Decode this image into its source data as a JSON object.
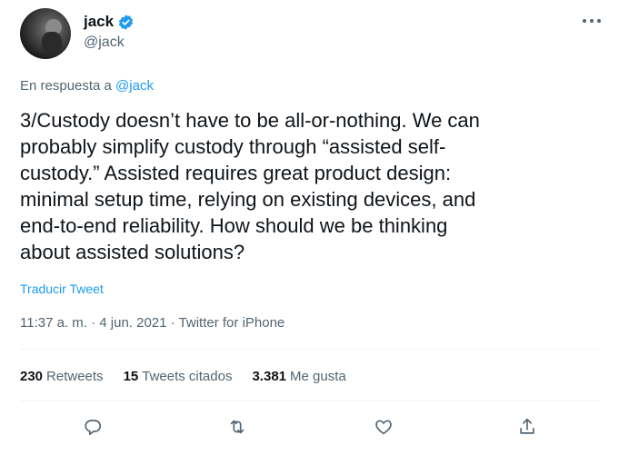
{
  "author": {
    "display_name": "jack",
    "handle": "@jack",
    "verified": true
  },
  "reply": {
    "prefix": "En respuesta a ",
    "to_handle": "@jack"
  },
  "tweet": {
    "text": "3/Custody doesn’t have to be all-or-nothing. We can\nprobably simplify custody through “assisted self-\ncustody.” Assisted requires great product design:\nminimal setup time, relying on existing devices, and\nend-to-end reliability. How should we be thinking\nabout assisted solutions?",
    "translate_label": "Traducir Tweet",
    "meta": "11:37 a. m. · 4 jun. 2021 · Twitter for iPhone"
  },
  "stats": {
    "retweets_count": "230",
    "retweets_label": "Retweets",
    "quotes_count": "15",
    "quotes_label": "Tweets citados",
    "likes_count": "3.381",
    "likes_label": "Me gusta"
  },
  "icons": {
    "more": "more-horizontal-icon",
    "verified": "verified-badge-icon",
    "reply": "reply-icon",
    "retweet": "retweet-icon",
    "like": "heart-icon",
    "share": "share-icon"
  },
  "colors": {
    "accent": "#1d9bf0",
    "text_primary": "#0f1419",
    "text_secondary": "#536471",
    "divider": "#eff3f4"
  }
}
